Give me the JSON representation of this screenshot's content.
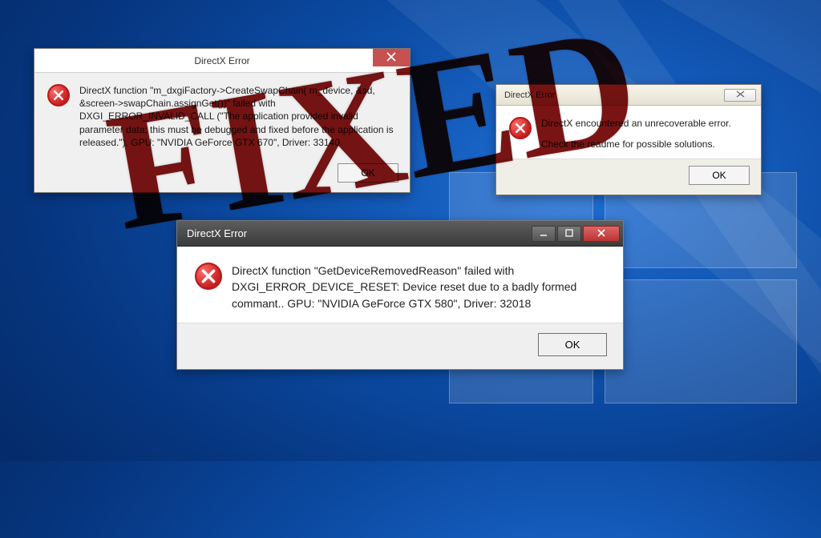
{
  "stamp_text": "FIXED",
  "dialog1": {
    "title": "DirectX Error",
    "message": "DirectX function \"m_dxgiFactory->CreateSwapChain( m_device, &sd, &screen->swapChain.assignGet())\" failed with DXGI_ERROR_INVALID_CALL (\"The application provided invalid parameter data; this must be debugged and fixed before the application is released.\"). GPU: \"NVIDIA GeForce GTX 670\", Driver: 33140",
    "ok_label": "OK"
  },
  "dialog2": {
    "title": "DirectX Error",
    "message_line1": "DirectX encountered an unrecoverable error.",
    "message_line2": "Check the readme for possible solutions.",
    "ok_label": "OK"
  },
  "dialog3": {
    "title": "DirectX Error",
    "message": "DirectX function \"GetDeviceRemovedReason\" failed with DXGI_ERROR_DEVICE_RESET: Device reset due to a badly formed commant.. GPU: \"NVIDIA GeForce GTX 580\", Driver: 32018",
    "ok_label": "OK"
  },
  "icon_semantics": {
    "error": "error-icon",
    "close": "close-icon",
    "minimize": "minimize-icon",
    "maximize": "maximize-icon"
  },
  "colors": {
    "bg_primary": "#0b4aa2",
    "bg_light": "#1f6fd6",
    "bg_dark": "#042a68",
    "stamp": "#7a1414",
    "error_red": "#c81e1e",
    "close_red": "#c75050"
  }
}
